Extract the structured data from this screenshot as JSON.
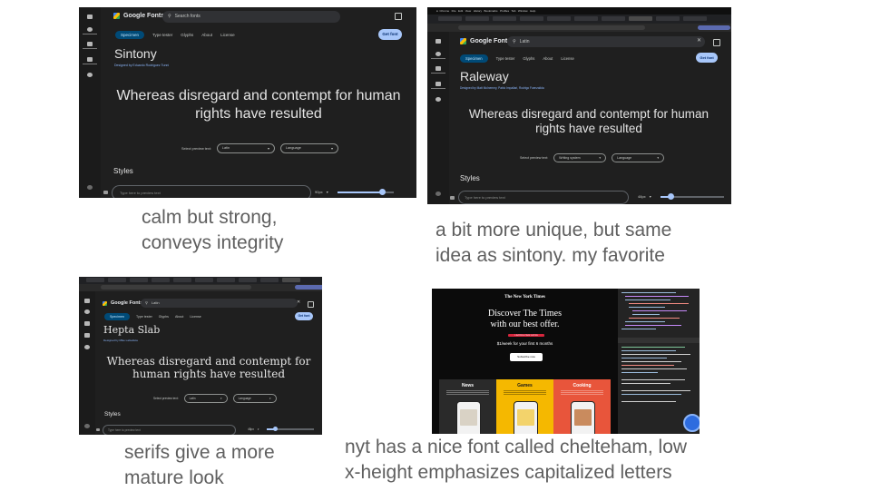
{
  "panels": [
    {
      "id": "sintony",
      "logo": "Google Fonts",
      "search_placeholder": "Search fonts",
      "search_value": "",
      "tabs": [
        "Specimen",
        "Type tester",
        "Glyphs",
        "About",
        "License"
      ],
      "get_font": "Get font",
      "font_name": "Sintony",
      "designer": "Designed by Eduardo Rodriguez Tunni",
      "sample": "Whereas disregard and contempt for human rights have resulted",
      "preview_label": "Select preview text:",
      "preview_select": "Latin",
      "language_select": "Language",
      "styles_heading": "Styles",
      "bottom_placeholder": "Type here to preview text",
      "size_value": "90px",
      "caption": [
        "calm but strong,",
        "conveys integrity"
      ]
    },
    {
      "id": "raleway",
      "logo": "Google Fonts",
      "search_value": "Latin",
      "tabs": [
        "Specimen",
        "Type tester",
        "Glyphs",
        "About",
        "License"
      ],
      "get_font": "Get font",
      "font_name": "Raleway",
      "designer": "Designed by Matt McInerney, Pablo Impallari, Rodrigo Fuenzalida",
      "sample": "Whereas disregard and contempt for human rights have resulted",
      "preview_label": "Select preview text:",
      "preview_select": "Writing system",
      "language_select": "Language",
      "styles_heading": "Styles",
      "bottom_placeholder": "Type here to preview text",
      "size_value": "48px",
      "menubar": [
        "Chrome",
        "File",
        "Edit",
        "View",
        "History",
        "Bookmarks",
        "Profiles",
        "Tab",
        "Window",
        "Help"
      ],
      "caption": [
        "a bit more unique, but same",
        "idea as sintony. my favorite"
      ]
    },
    {
      "id": "hepta-slab",
      "logo": "Google Fonts",
      "search_value": "Latin",
      "tabs": [
        "Specimen",
        "Type tester",
        "Glyphs",
        "About",
        "License"
      ],
      "get_font": "Get font",
      "font_name": "Hepta Slab",
      "designer": "Designed by Mike LaGattuta",
      "sample": "Whereas disregard and contempt for human rights have resulted",
      "preview_label": "Select preview text:",
      "preview_select": "Latin",
      "language_select": "Language",
      "styles_heading": "Styles",
      "bottom_placeholder": "Type here to preview text",
      "size_value": "48px",
      "caption": [
        "serifs give a more",
        "mature look"
      ]
    }
  ],
  "nyt": {
    "masthead": "The New York Times",
    "headline_1": "Discover The Times",
    "headline_2": "with our best offer.",
    "badge": "LIMITED-TIME OFFER",
    "price": "$1/week for your first 6 months",
    "subscribe": "Subscribe now",
    "products": [
      "News",
      "Games",
      "Cooking"
    ],
    "caption": [
      "nyt has a nice font called chelteham, low",
      "x-height emphasizes capitalized letters"
    ]
  },
  "colors": {
    "caption_gray": "#5f5f5f",
    "gf_background": "#1f1f1f",
    "gf_accent": "#a8c7fa",
    "gf_active_tab": "#004a77",
    "nyt_games": "#f5b800",
    "nyt_cooking": "#e8553b",
    "nyt_news": "#2a2a2a"
  }
}
